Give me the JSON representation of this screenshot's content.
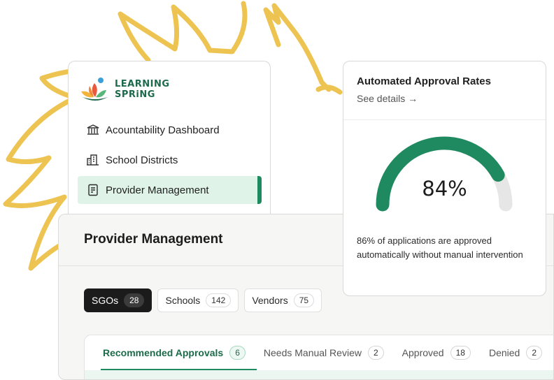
{
  "brand": {
    "line1": "LEARNING",
    "line2": "SPRiNG",
    "color": "#1d6a4c"
  },
  "sidebar": {
    "items": [
      {
        "label": "Acountability Dashboard",
        "icon": "bank-icon",
        "active": false
      },
      {
        "label": "School Districts",
        "icon": "building-icon",
        "active": false
      },
      {
        "label": "Provider Management",
        "icon": "document-icon",
        "active": true
      }
    ]
  },
  "main": {
    "title": "Provider Management",
    "chips": [
      {
        "label": "SGOs",
        "count": "28",
        "active": true
      },
      {
        "label": "Schools",
        "count": "142",
        "active": false
      },
      {
        "label": "Vendors",
        "count": "75",
        "active": false
      }
    ],
    "tabs": [
      {
        "label": "Recommended Approvals",
        "count": "6",
        "active": true
      },
      {
        "label": "Needs Manual Review",
        "count": "2",
        "active": false
      },
      {
        "label": "Approved",
        "count": "18",
        "active": false
      },
      {
        "label": "Denied",
        "count": "2",
        "active": false
      }
    ]
  },
  "approval": {
    "title": "Automated Approval Rates",
    "link": "See details →",
    "value_text": "84%",
    "fraction": 0.84,
    "description": "86% of applications are approved automatically without manual intervention",
    "accent": "#1f8a60",
    "track": "#e6e6e6"
  },
  "colors": {
    "sun": "#edc452",
    "accent": "#1f8a60",
    "active_bg": "#dff3e8"
  }
}
